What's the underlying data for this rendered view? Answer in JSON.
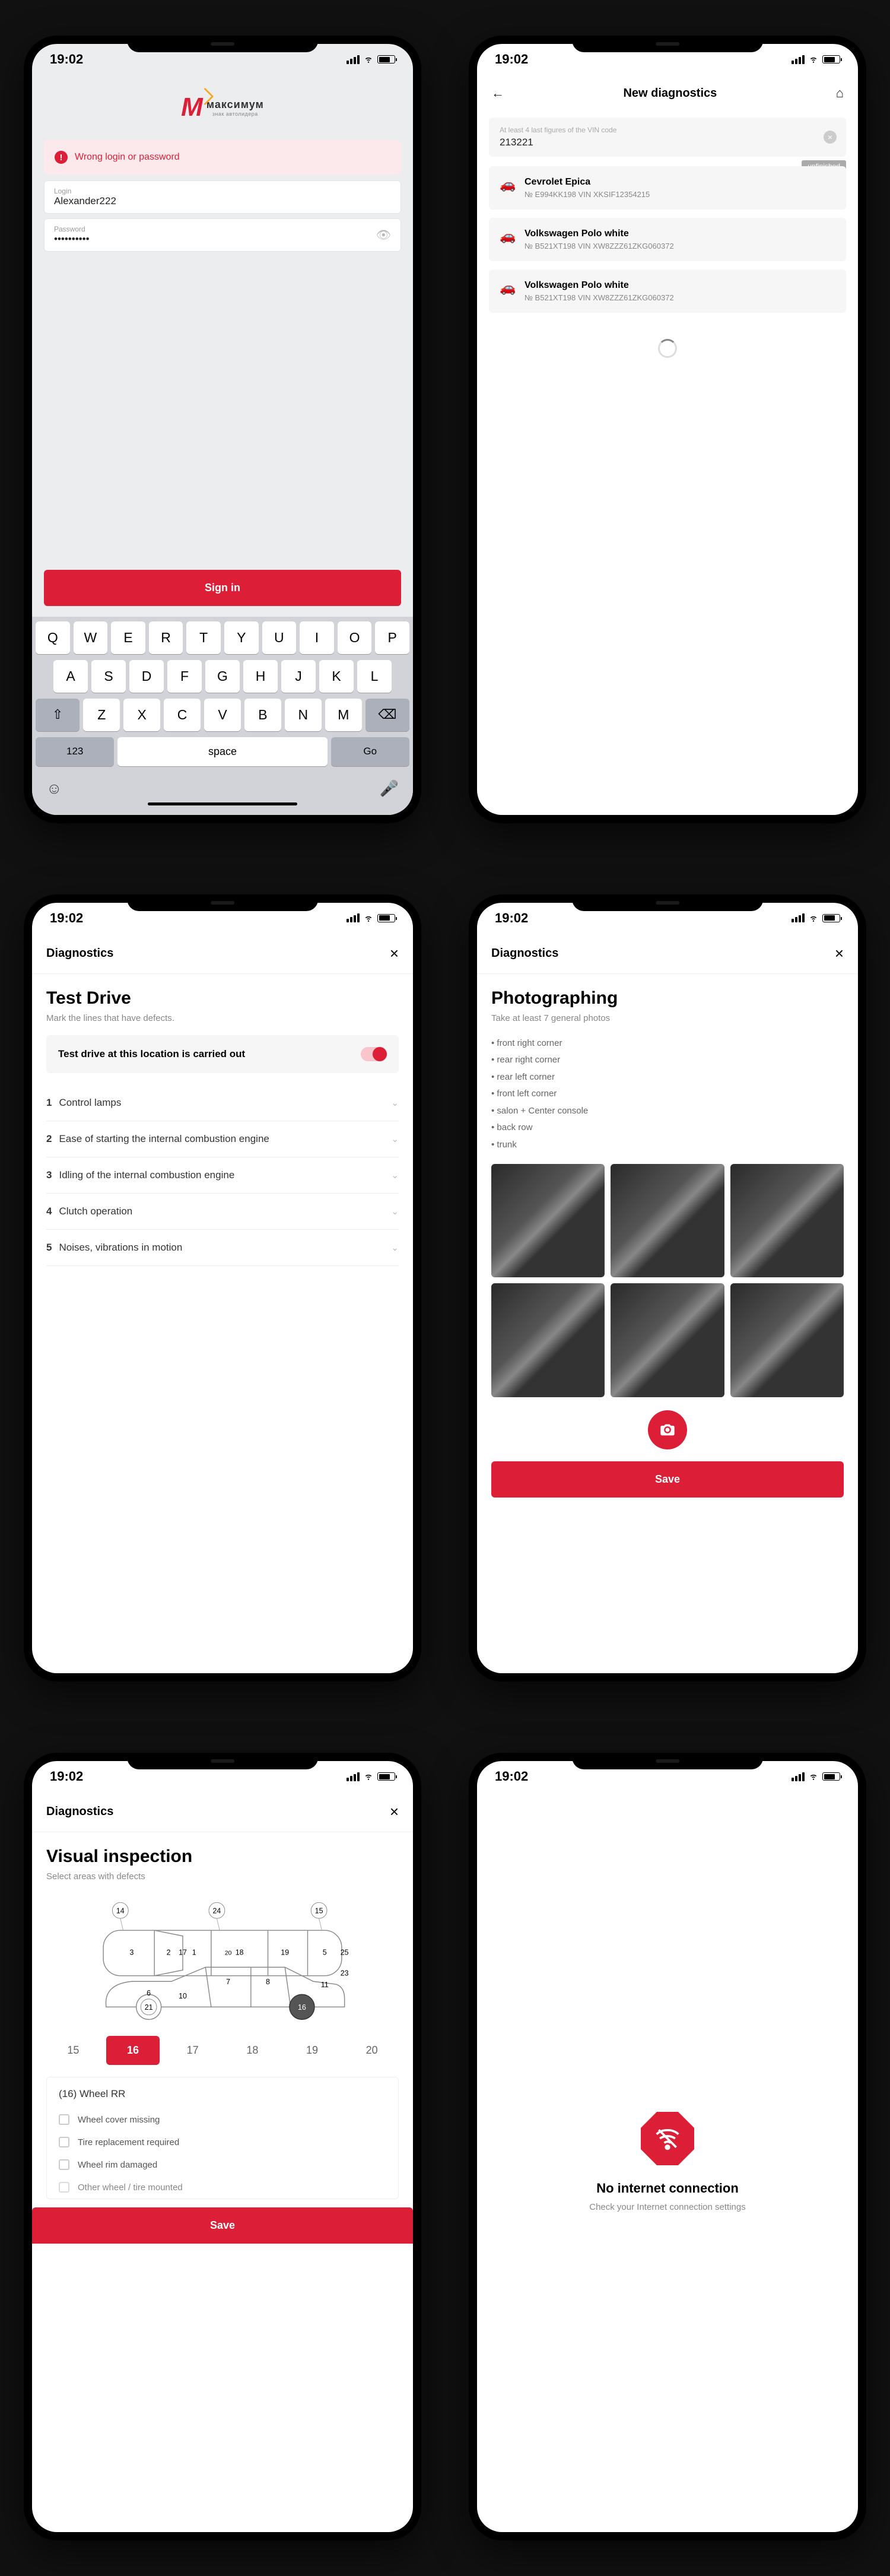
{
  "time": "19:02",
  "s1": {
    "logo_text": "максимум",
    "logo_sub": "знак автолидера",
    "alert": "Wrong login or password",
    "login_label": "Login",
    "login_value": "Alexander222",
    "password_label": "Password",
    "password_value": "••••••••••",
    "signin": "Sign in",
    "key_rows": {
      "r1": [
        "Q",
        "W",
        "E",
        "R",
        "T",
        "Y",
        "U",
        "I",
        "O",
        "P"
      ],
      "r2": [
        "A",
        "S",
        "D",
        "F",
        "G",
        "H",
        "J",
        "K",
        "L"
      ],
      "r3": [
        "Z",
        "X",
        "C",
        "V",
        "B",
        "N",
        "M"
      ]
    },
    "key_123": "123",
    "key_space": "space",
    "key_go": "Go"
  },
  "s2": {
    "title": "New diagnostics",
    "vin_hint": "At least 4 last figures of the VIN code",
    "vin_value": "213221",
    "tag": "unfinished",
    "cars": [
      {
        "name": "Cevrolet Epica",
        "detail": "№ E994KK198 VIN XKSIF12354215"
      },
      {
        "name": "Volkswagen Polo white",
        "detail": "№ B521XT198 VIN XW8ZZZ61ZKG060372"
      },
      {
        "name": "Volkswagen Polo white",
        "detail": "№ B521XT198 VIN XW8ZZZ61ZKG060372"
      }
    ]
  },
  "s3": {
    "bar": "Diagnostics",
    "title": "Test Drive",
    "sub": "Mark the lines that have defects.",
    "toggle": "Test drive at this location is carried out",
    "items": [
      {
        "n": "1",
        "t": "Control lamps"
      },
      {
        "n": "2",
        "t": "Ease of starting the internal combustion engine"
      },
      {
        "n": "3",
        "t": "Idling of the internal combustion engine"
      },
      {
        "n": "4",
        "t": "Clutch operation"
      },
      {
        "n": "5",
        "t": "Noises, vibrations in motion"
      }
    ]
  },
  "s4": {
    "bar": "Diagnostics",
    "title": "Photographing",
    "sub": "Take at least 7 general photos",
    "bullets": [
      "front right corner",
      "rear right corner",
      "rear left corner",
      "front left corner",
      "salon + Center console",
      "back row",
      "trunk"
    ],
    "save": "Save"
  },
  "s5": {
    "bar": "Diagnostics",
    "title": "Visual inspection",
    "sub": "Select areas with defects",
    "diagram_labels": [
      "14",
      "24",
      "15",
      "3",
      "2",
      "1",
      "5",
      "25",
      "17",
      "18",
      "19",
      "11",
      "23",
      "20",
      "6",
      "7",
      "8",
      "10",
      "16",
      "21"
    ],
    "zones": [
      "15",
      "16",
      "17",
      "18",
      "19",
      "20"
    ],
    "active_zone": "16",
    "group_title": "(16) Wheel RR",
    "checks": [
      "Wheel cover missing",
      "Tire replacement required",
      "Wheel rim damaged",
      "Other wheel / tire mounted"
    ],
    "save": "Save"
  },
  "s6": {
    "title": "No internet connection",
    "sub": "Check your Internet connection settings"
  }
}
